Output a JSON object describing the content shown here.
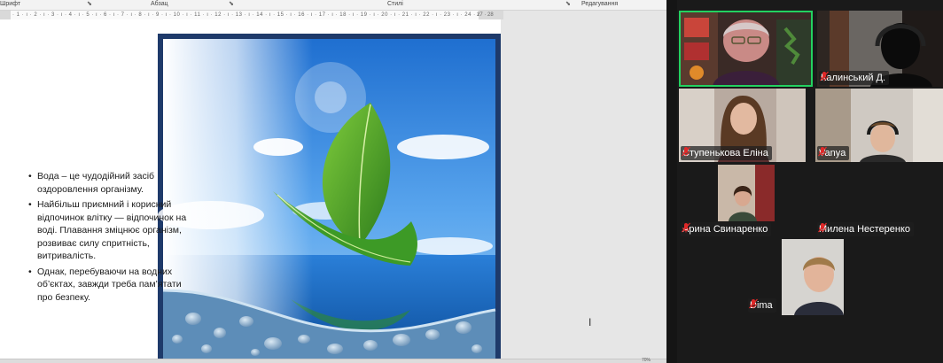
{
  "word": {
    "ribbon_groups": [
      "Шрифт",
      "Абзац",
      "Стилі",
      "Редагування"
    ],
    "ruler_text": "· 1 · ı · 2 · ı · 3 · ı · 4 · ı · 5 · ı · 6 · ı · 7 · ı · 8 · ı · 9 · ı · 10 · ı · 11 · ı · 12 · ı · 13 · ı · 14 · ı · 15 · ı · 16 · ı · 17 · ı · 18 · ı · 19 · ı · 20 · ı · 21 · ı · 22 · ı · 23 · ı · 24 · ı · 25 · ı · 26 ·",
    "ruler_end": "27 · 28",
    "bullets": [
      "Вода – це чудодійний засіб оздоровлення організму.",
      "Найбільш приємний і корисний відпочинок влітку — відпочинок на воді. Плавання зміцнює організм, розвиває силу спритність, витривалість.",
      "Однак, перебуваючи на водних об’єктах, завжди треба пам’ятати про безпеку."
    ],
    "cursor_glyph": "I",
    "zoom_text": "70%"
  },
  "participants": [
    {
      "name": "",
      "muted": false,
      "speaking": true
    },
    {
      "name": "Калинський Д.",
      "muted": true
    },
    {
      "name": "Ступенькова Еліна",
      "muted": true
    },
    {
      "name": "Vanya",
      "muted": true
    },
    {
      "name": "Арина Свинаренко",
      "muted": true
    },
    {
      "name": "Милена Нестеренко",
      "muted": true
    },
    {
      "name": "Dima",
      "muted": true
    }
  ],
  "colors": {
    "speaker_border": "#23d160",
    "muted_mic": "#e02828",
    "gallery_bg": "#1a1a1a"
  },
  "icons": [
    "dialog-launcher-icon",
    "muted-mic-icon",
    "text-cursor-icon",
    "leaf-boat-image"
  ]
}
